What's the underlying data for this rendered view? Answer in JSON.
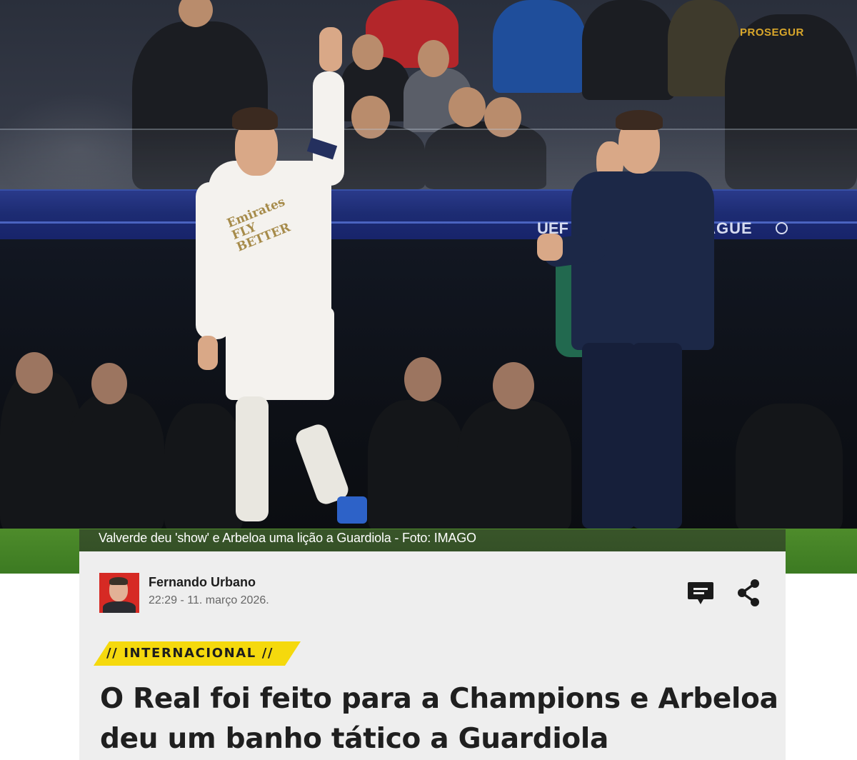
{
  "photo": {
    "stadium_board": {
      "sponsor_sign": "PROSEGUR",
      "league_left": "UEF",
      "league_right": "LEAGUE"
    },
    "jersey_sponsor": "Emirates FLY BETTER",
    "caption": "Valverde deu 'show' e Arbeloa uma lição a Guardiola - Foto: IMAGO"
  },
  "author": {
    "name": "Fernando Urbano",
    "datetime": "22:29 - 11. março 2026."
  },
  "actions": {
    "comment_icon": "comment-icon",
    "share_icon": "share-icon"
  },
  "article": {
    "category": "// INTERNACIONAL //",
    "headline": "O Real foi feito para a Champions e Arbeloa deu um banho tático a Guardiola"
  },
  "colors": {
    "category_tag": "#f5d90d",
    "card_background": "#eeeeee",
    "caption_text": "#ffffff",
    "avatar_background": "#d62a24"
  }
}
